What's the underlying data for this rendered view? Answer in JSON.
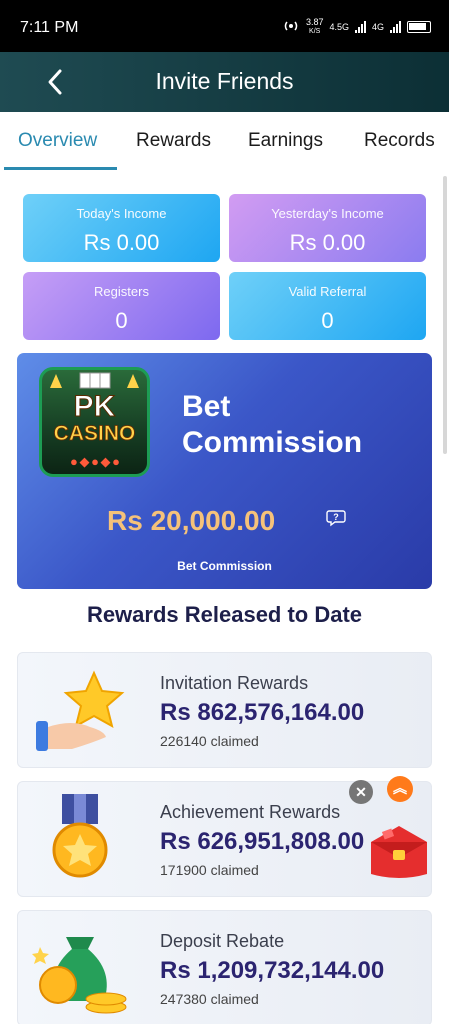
{
  "status_bar": {
    "time": "7:11 PM",
    "speed_value": "3.87",
    "speed_unit": "K/S",
    "network_1": "4.5G",
    "network_2": "4G"
  },
  "header": {
    "title": "Invite Friends",
    "back_icon": "chevron-left-icon"
  },
  "tabs": [
    {
      "label": "Overview",
      "active": true
    },
    {
      "label": "Rewards",
      "active": false
    },
    {
      "label": "Earnings",
      "active": false
    },
    {
      "label": "Records",
      "active": false
    }
  ],
  "stats": [
    {
      "label": "Today's Income",
      "value": "Rs 0.00"
    },
    {
      "label": "Yesterday's Income",
      "value": "Rs 0.00"
    },
    {
      "label": "Registers",
      "value": "0"
    },
    {
      "label": "Valid Referral",
      "value": "0"
    }
  ],
  "bet_commission": {
    "logo_line1": "PK",
    "logo_line2": "CASINO",
    "title": "Bet Commission",
    "amount": "Rs 20,000.00",
    "subtitle": "Bet Commission",
    "help_icon": "question-bubble-icon"
  },
  "section_title": "Rewards Released to Date",
  "rewards": [
    {
      "title": "Invitation Rewards",
      "amount": "Rs  862,576,164.00",
      "claimed": "226140 claimed",
      "icon": "star-hand-icon"
    },
    {
      "title": "Achievement Rewards",
      "amount": "Rs  626,951,808.00",
      "claimed": "171900 claimed",
      "icon": "medal-icon"
    },
    {
      "title": "Deposit Rebate",
      "amount": "Rs  1,209,732,144.00",
      "claimed": "247380 claimed",
      "icon": "money-bag-icon"
    }
  ],
  "floating": {
    "close_glyph": "✕",
    "up_glyph": "︽"
  },
  "colors": {
    "accent": "#2a8ab0",
    "header_bg": "#1f4b52",
    "amount_gold": "#f5c27a",
    "reward_amount": "#2b2470"
  }
}
